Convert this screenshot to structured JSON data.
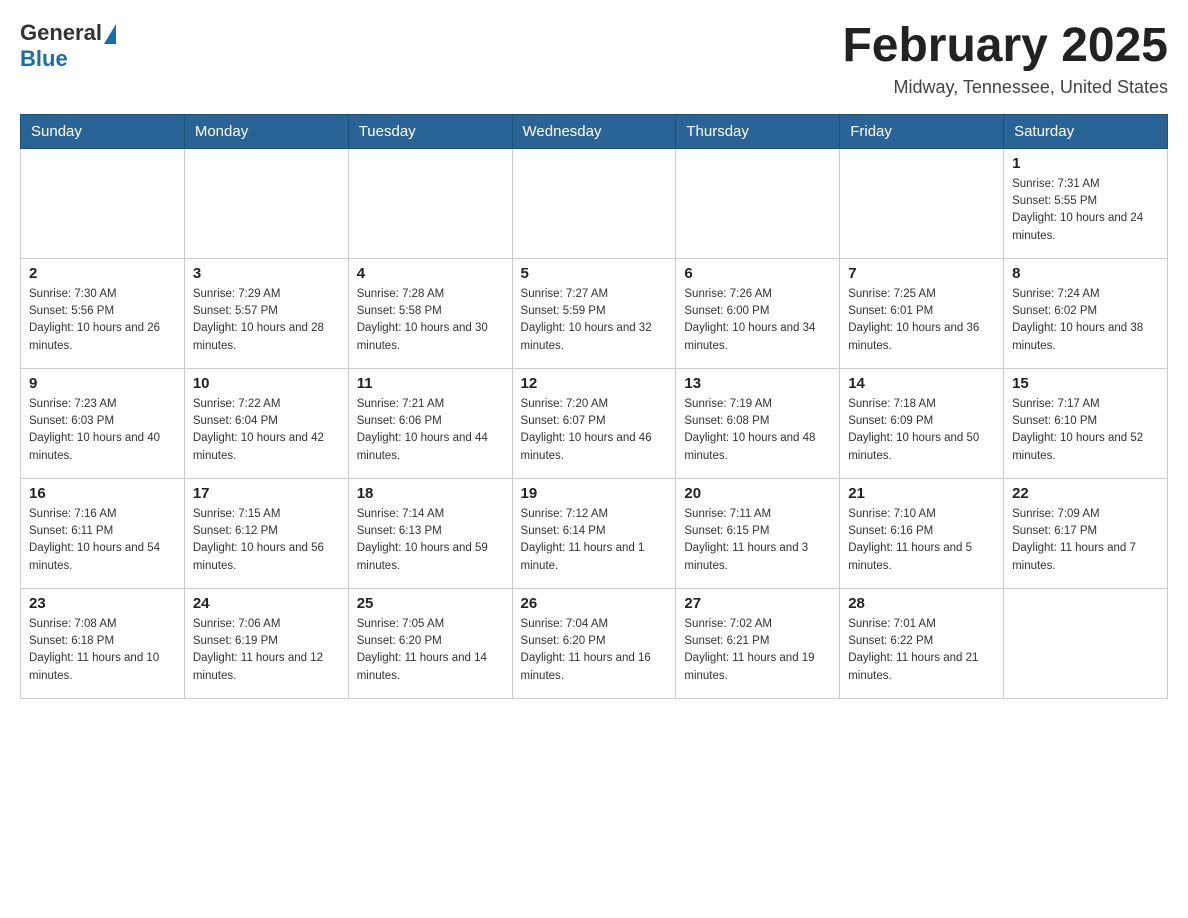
{
  "header": {
    "logo_general": "General",
    "logo_blue": "Blue",
    "month_title": "February 2025",
    "location": "Midway, Tennessee, United States"
  },
  "weekdays": [
    "Sunday",
    "Monday",
    "Tuesday",
    "Wednesday",
    "Thursday",
    "Friday",
    "Saturday"
  ],
  "weeks": [
    [
      {
        "day": "",
        "info": ""
      },
      {
        "day": "",
        "info": ""
      },
      {
        "day": "",
        "info": ""
      },
      {
        "day": "",
        "info": ""
      },
      {
        "day": "",
        "info": ""
      },
      {
        "day": "",
        "info": ""
      },
      {
        "day": "1",
        "info": "Sunrise: 7:31 AM\nSunset: 5:55 PM\nDaylight: 10 hours and 24 minutes."
      }
    ],
    [
      {
        "day": "2",
        "info": "Sunrise: 7:30 AM\nSunset: 5:56 PM\nDaylight: 10 hours and 26 minutes."
      },
      {
        "day": "3",
        "info": "Sunrise: 7:29 AM\nSunset: 5:57 PM\nDaylight: 10 hours and 28 minutes."
      },
      {
        "day": "4",
        "info": "Sunrise: 7:28 AM\nSunset: 5:58 PM\nDaylight: 10 hours and 30 minutes."
      },
      {
        "day": "5",
        "info": "Sunrise: 7:27 AM\nSunset: 5:59 PM\nDaylight: 10 hours and 32 minutes."
      },
      {
        "day": "6",
        "info": "Sunrise: 7:26 AM\nSunset: 6:00 PM\nDaylight: 10 hours and 34 minutes."
      },
      {
        "day": "7",
        "info": "Sunrise: 7:25 AM\nSunset: 6:01 PM\nDaylight: 10 hours and 36 minutes."
      },
      {
        "day": "8",
        "info": "Sunrise: 7:24 AM\nSunset: 6:02 PM\nDaylight: 10 hours and 38 minutes."
      }
    ],
    [
      {
        "day": "9",
        "info": "Sunrise: 7:23 AM\nSunset: 6:03 PM\nDaylight: 10 hours and 40 minutes."
      },
      {
        "day": "10",
        "info": "Sunrise: 7:22 AM\nSunset: 6:04 PM\nDaylight: 10 hours and 42 minutes."
      },
      {
        "day": "11",
        "info": "Sunrise: 7:21 AM\nSunset: 6:06 PM\nDaylight: 10 hours and 44 minutes."
      },
      {
        "day": "12",
        "info": "Sunrise: 7:20 AM\nSunset: 6:07 PM\nDaylight: 10 hours and 46 minutes."
      },
      {
        "day": "13",
        "info": "Sunrise: 7:19 AM\nSunset: 6:08 PM\nDaylight: 10 hours and 48 minutes."
      },
      {
        "day": "14",
        "info": "Sunrise: 7:18 AM\nSunset: 6:09 PM\nDaylight: 10 hours and 50 minutes."
      },
      {
        "day": "15",
        "info": "Sunrise: 7:17 AM\nSunset: 6:10 PM\nDaylight: 10 hours and 52 minutes."
      }
    ],
    [
      {
        "day": "16",
        "info": "Sunrise: 7:16 AM\nSunset: 6:11 PM\nDaylight: 10 hours and 54 minutes."
      },
      {
        "day": "17",
        "info": "Sunrise: 7:15 AM\nSunset: 6:12 PM\nDaylight: 10 hours and 56 minutes."
      },
      {
        "day": "18",
        "info": "Sunrise: 7:14 AM\nSunset: 6:13 PM\nDaylight: 10 hours and 59 minutes."
      },
      {
        "day": "19",
        "info": "Sunrise: 7:12 AM\nSunset: 6:14 PM\nDaylight: 11 hours and 1 minute."
      },
      {
        "day": "20",
        "info": "Sunrise: 7:11 AM\nSunset: 6:15 PM\nDaylight: 11 hours and 3 minutes."
      },
      {
        "day": "21",
        "info": "Sunrise: 7:10 AM\nSunset: 6:16 PM\nDaylight: 11 hours and 5 minutes."
      },
      {
        "day": "22",
        "info": "Sunrise: 7:09 AM\nSunset: 6:17 PM\nDaylight: 11 hours and 7 minutes."
      }
    ],
    [
      {
        "day": "23",
        "info": "Sunrise: 7:08 AM\nSunset: 6:18 PM\nDaylight: 11 hours and 10 minutes."
      },
      {
        "day": "24",
        "info": "Sunrise: 7:06 AM\nSunset: 6:19 PM\nDaylight: 11 hours and 12 minutes."
      },
      {
        "day": "25",
        "info": "Sunrise: 7:05 AM\nSunset: 6:20 PM\nDaylight: 11 hours and 14 minutes."
      },
      {
        "day": "26",
        "info": "Sunrise: 7:04 AM\nSunset: 6:20 PM\nDaylight: 11 hours and 16 minutes."
      },
      {
        "day": "27",
        "info": "Sunrise: 7:02 AM\nSunset: 6:21 PM\nDaylight: 11 hours and 19 minutes."
      },
      {
        "day": "28",
        "info": "Sunrise: 7:01 AM\nSunset: 6:22 PM\nDaylight: 11 hours and 21 minutes."
      },
      {
        "day": "",
        "info": ""
      }
    ]
  ]
}
